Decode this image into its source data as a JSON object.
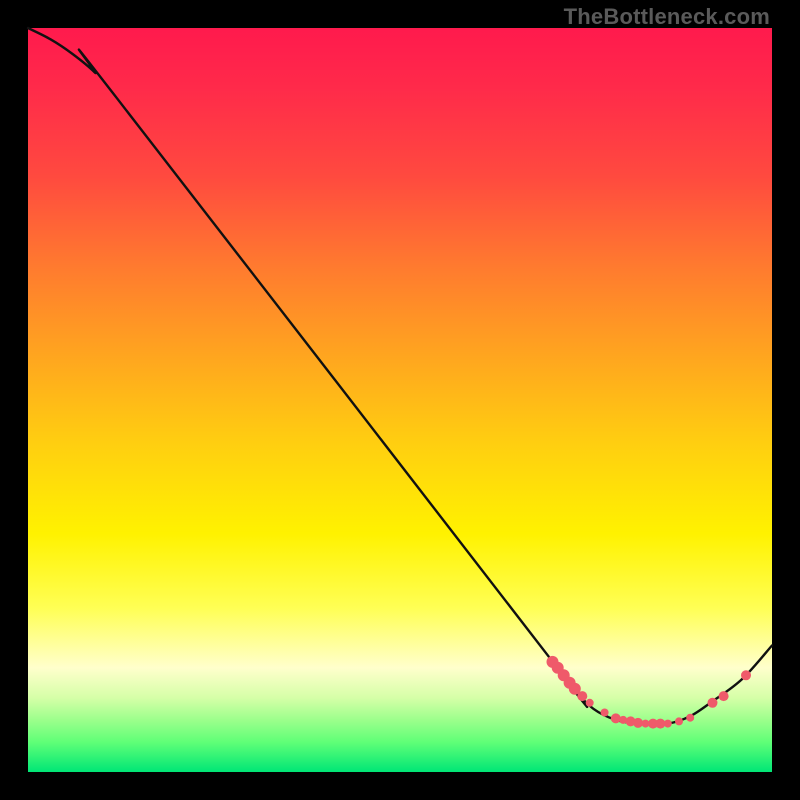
{
  "watermark": "TheBottleneck.com",
  "chart_data": {
    "type": "line",
    "title": "",
    "xlabel": "",
    "ylabel": "",
    "xlim": [
      0,
      1
    ],
    "ylim": [
      0,
      1
    ],
    "curve": [
      {
        "x": 0.0,
        "y": 1.0
      },
      {
        "x": 0.03,
        "y": 0.985
      },
      {
        "x": 0.06,
        "y": 0.965
      },
      {
        "x": 0.09,
        "y": 0.94
      },
      {
        "x": 0.12,
        "y": 0.905
      },
      {
        "x": 0.7,
        "y": 0.155
      },
      {
        "x": 0.73,
        "y": 0.115
      },
      {
        "x": 0.76,
        "y": 0.085
      },
      {
        "x": 0.79,
        "y": 0.07
      },
      {
        "x": 0.82,
        "y": 0.065
      },
      {
        "x": 0.86,
        "y": 0.065
      },
      {
        "x": 0.89,
        "y": 0.075
      },
      {
        "x": 0.92,
        "y": 0.095
      },
      {
        "x": 0.96,
        "y": 0.125
      },
      {
        "x": 1.0,
        "y": 0.17
      }
    ],
    "markers": [
      {
        "x": 0.705,
        "y": 0.148,
        "r": 6
      },
      {
        "x": 0.712,
        "y": 0.14,
        "r": 6
      },
      {
        "x": 0.72,
        "y": 0.13,
        "r": 6
      },
      {
        "x": 0.728,
        "y": 0.12,
        "r": 6
      },
      {
        "x": 0.735,
        "y": 0.112,
        "r": 6
      },
      {
        "x": 0.745,
        "y": 0.102,
        "r": 5
      },
      {
        "x": 0.755,
        "y": 0.093,
        "r": 4
      },
      {
        "x": 0.775,
        "y": 0.08,
        "r": 4
      },
      {
        "x": 0.79,
        "y": 0.072,
        "r": 5
      },
      {
        "x": 0.8,
        "y": 0.07,
        "r": 4
      },
      {
        "x": 0.81,
        "y": 0.068,
        "r": 5
      },
      {
        "x": 0.82,
        "y": 0.066,
        "r": 5
      },
      {
        "x": 0.83,
        "y": 0.065,
        "r": 4
      },
      {
        "x": 0.84,
        "y": 0.065,
        "r": 5
      },
      {
        "x": 0.85,
        "y": 0.065,
        "r": 5
      },
      {
        "x": 0.86,
        "y": 0.065,
        "r": 4
      },
      {
        "x": 0.875,
        "y": 0.068,
        "r": 4
      },
      {
        "x": 0.89,
        "y": 0.073,
        "r": 4
      },
      {
        "x": 0.92,
        "y": 0.093,
        "r": 5
      },
      {
        "x": 0.935,
        "y": 0.102,
        "r": 5
      },
      {
        "x": 0.965,
        "y": 0.13,
        "r": 5
      }
    ]
  }
}
